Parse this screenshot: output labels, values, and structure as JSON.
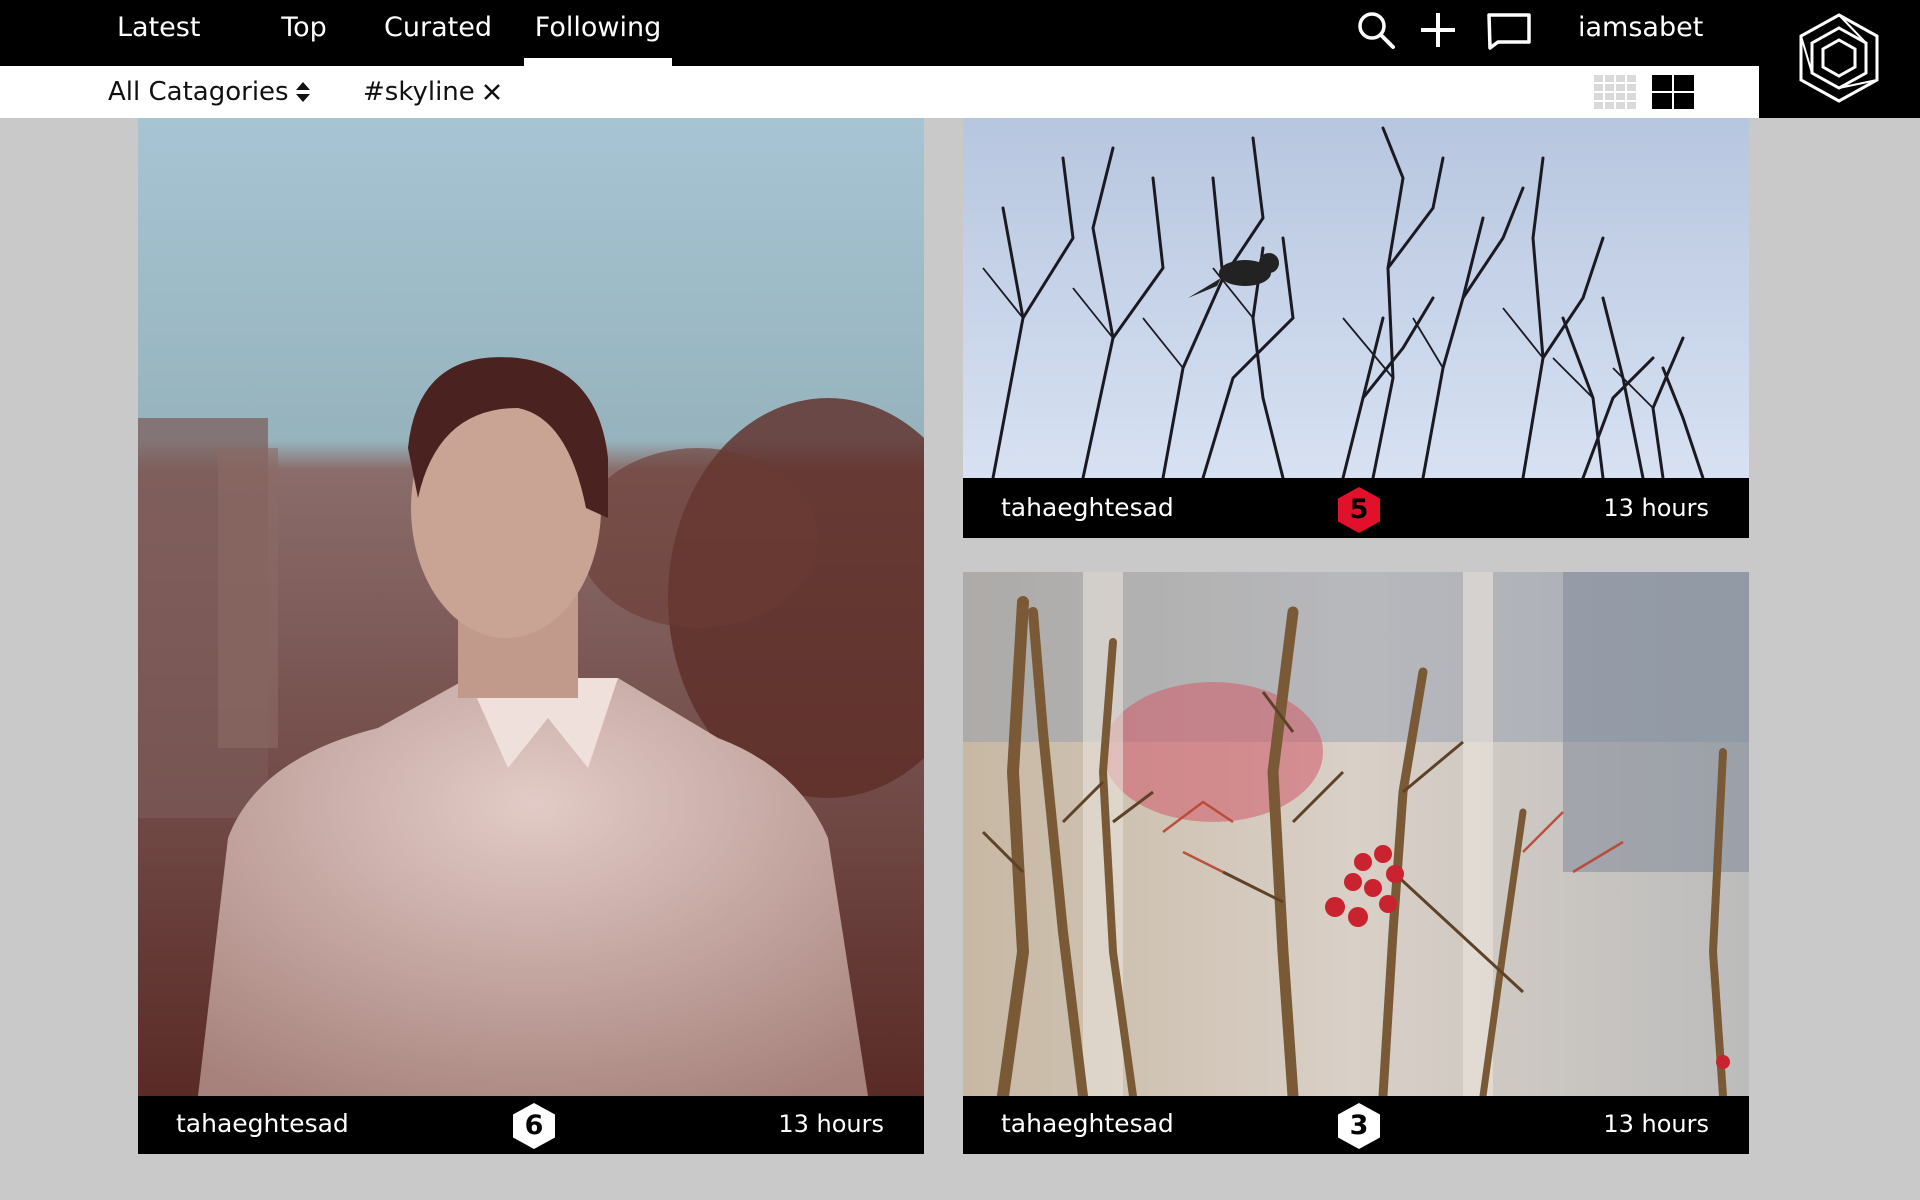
{
  "nav": {
    "tabs": [
      {
        "label": "Latest"
      },
      {
        "label": "Top"
      },
      {
        "label": "Curated"
      },
      {
        "label": "Following",
        "active": true
      }
    ],
    "username": "iamsabet",
    "icons": [
      "search-icon",
      "plus-icon",
      "message-icon",
      "hexagon-logo-icon"
    ]
  },
  "filters": {
    "category": "All Catagories",
    "tag": "#skyline",
    "view_icons": [
      "grid-small-icon",
      "grid-large-icon"
    ]
  },
  "colors": {
    "topbar": "#000000",
    "filterbar": "#ffffff",
    "background": "#c9c9c9",
    "badge_red": "#e3102b",
    "badge_white": "#ffffff"
  },
  "posts": [
    {
      "author": "tahaeghtesad",
      "badge": "6",
      "badge_color": "white",
      "time": "13 hours",
      "image": "portrait of a young man in a light shirt with blurred city background"
    },
    {
      "author": "tahaeghtesad",
      "badge": "5",
      "badge_color": "red",
      "time": "13 hours",
      "image": "bird silhouette on bare branches against a pale blue sky"
    },
    {
      "author": "tahaeghtesad",
      "badge": "3",
      "badge_color": "white",
      "time": "13 hours",
      "image": "close-up of dry stems with small red berries"
    }
  ]
}
